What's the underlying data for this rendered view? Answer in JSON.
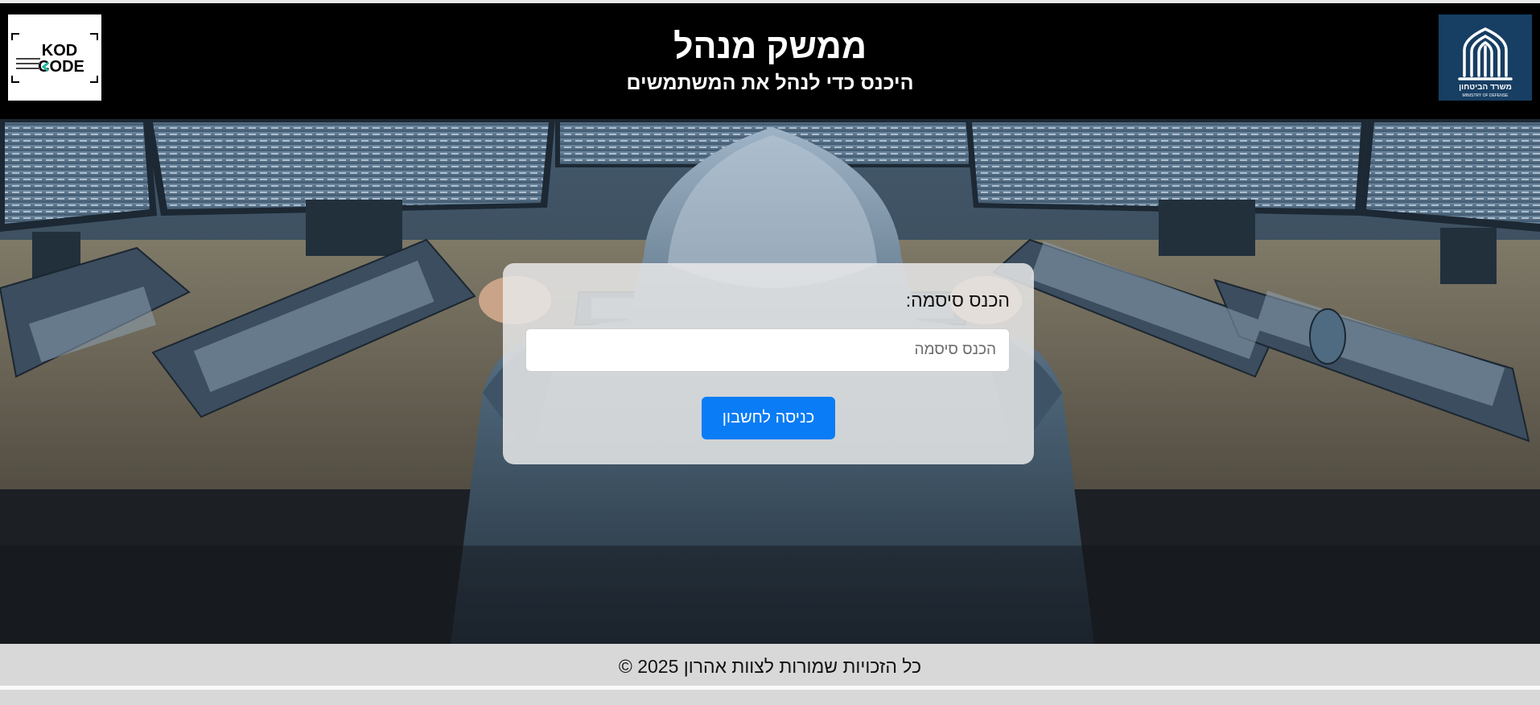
{
  "header": {
    "title": "ממשק מנהל",
    "subtitle": "היכנס כדי לנהל את המשתמשים"
  },
  "logos": {
    "left": {
      "name": "KODCODE",
      "icon": "kodcode-logo",
      "wordmark_top": "KOD",
      "wordmark_bottom": "CODE"
    },
    "right": {
      "name": "משרד הביטחון",
      "icon": "ministry-of-defense-logo",
      "subtext": "MINISTRY OF DEFENSE"
    }
  },
  "login": {
    "label": "הכנס סיסמה:",
    "password_placeholder": "הכנס סיסמה",
    "password_value": "",
    "submit_label": "כניסה לחשבון"
  },
  "footer": {
    "text": "כל הזכויות שמורות לצוות אהרון 2025 ©"
  },
  "colors": {
    "header_bg": "#000000",
    "button_bg": "#0a7cf6",
    "card_bg": "#e8e8e8",
    "footer_bg": "#d7d7d7",
    "mod_logo_bg": "#173e63"
  },
  "background_image": "hooded-hacker-at-computer-desk"
}
